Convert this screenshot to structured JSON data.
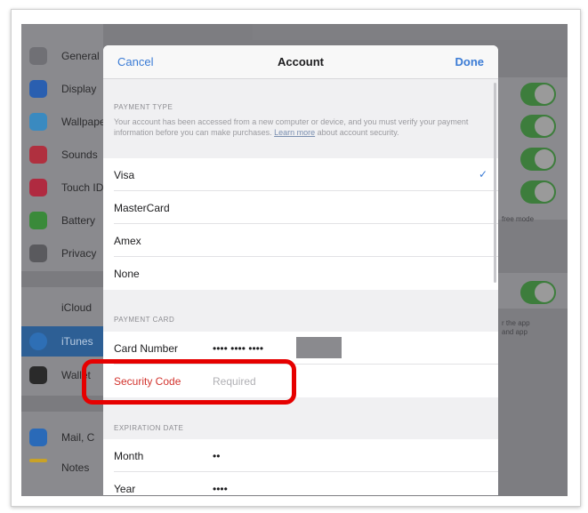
{
  "sidebar": {
    "items": [
      {
        "label": "General",
        "icon": "gear-icon",
        "color": "#707075"
      },
      {
        "label": "Display",
        "icon": "display-icon",
        "color": "#2a5fb0"
      },
      {
        "label": "Wallpaper",
        "icon": "wallpaper-icon",
        "color": "#3a8ac0"
      },
      {
        "label": "Sounds",
        "icon": "sound-icon",
        "color": "#b0303f"
      },
      {
        "label": "Touch ID",
        "icon": "fingerprint-icon",
        "color": "#b02a40"
      },
      {
        "label": "Battery",
        "icon": "battery-icon",
        "color": "#3a8a3a"
      },
      {
        "label": "Privacy",
        "icon": "hand-icon",
        "color": "#5a5a5e"
      },
      {
        "label": "iCloud",
        "icon": "cloud-icon",
        "color": "#8a8a8e"
      },
      {
        "label": "iTunes",
        "icon": "app-store-icon",
        "color": "#2e6fb5"
      },
      {
        "label": "Wallet",
        "icon": "wallet-icon",
        "color": "#2a2a2a"
      },
      {
        "label": "Mail, C",
        "icon": "mail-icon",
        "color": "#2a6ab8"
      },
      {
        "label": "Notes",
        "icon": "notes-icon",
        "color": "#c9a227"
      }
    ]
  },
  "background_right": {
    "note1": "free mode",
    "note2": "r the app\nand app"
  },
  "modal": {
    "cancel": "Cancel",
    "title": "Account",
    "done": "Done",
    "payment_type": {
      "title": "PAYMENT TYPE",
      "desc_before_link": "Your account has been accessed from a new computer or device, and you must verify your payment information before you can make purchases.",
      "link": "Learn more",
      "desc_after_link": "about account security.",
      "options": [
        "Visa",
        "MasterCard",
        "Amex",
        "None"
      ],
      "selected": "Visa"
    },
    "payment_card": {
      "title": "PAYMENT CARD",
      "card_number_label": "Card Number",
      "card_number_value": "•••• •••• ••••",
      "security_code_label": "Security Code",
      "security_code_placeholder": "Required"
    },
    "expiration_date": {
      "title": "EXPIRATION DATE",
      "month_label": "Month",
      "month_value": "••",
      "year_label": "Year",
      "year_value": "••••"
    }
  },
  "colors": {
    "accent": "#3a7bd5",
    "error": "#d2332d",
    "highlight": "#e60000"
  }
}
